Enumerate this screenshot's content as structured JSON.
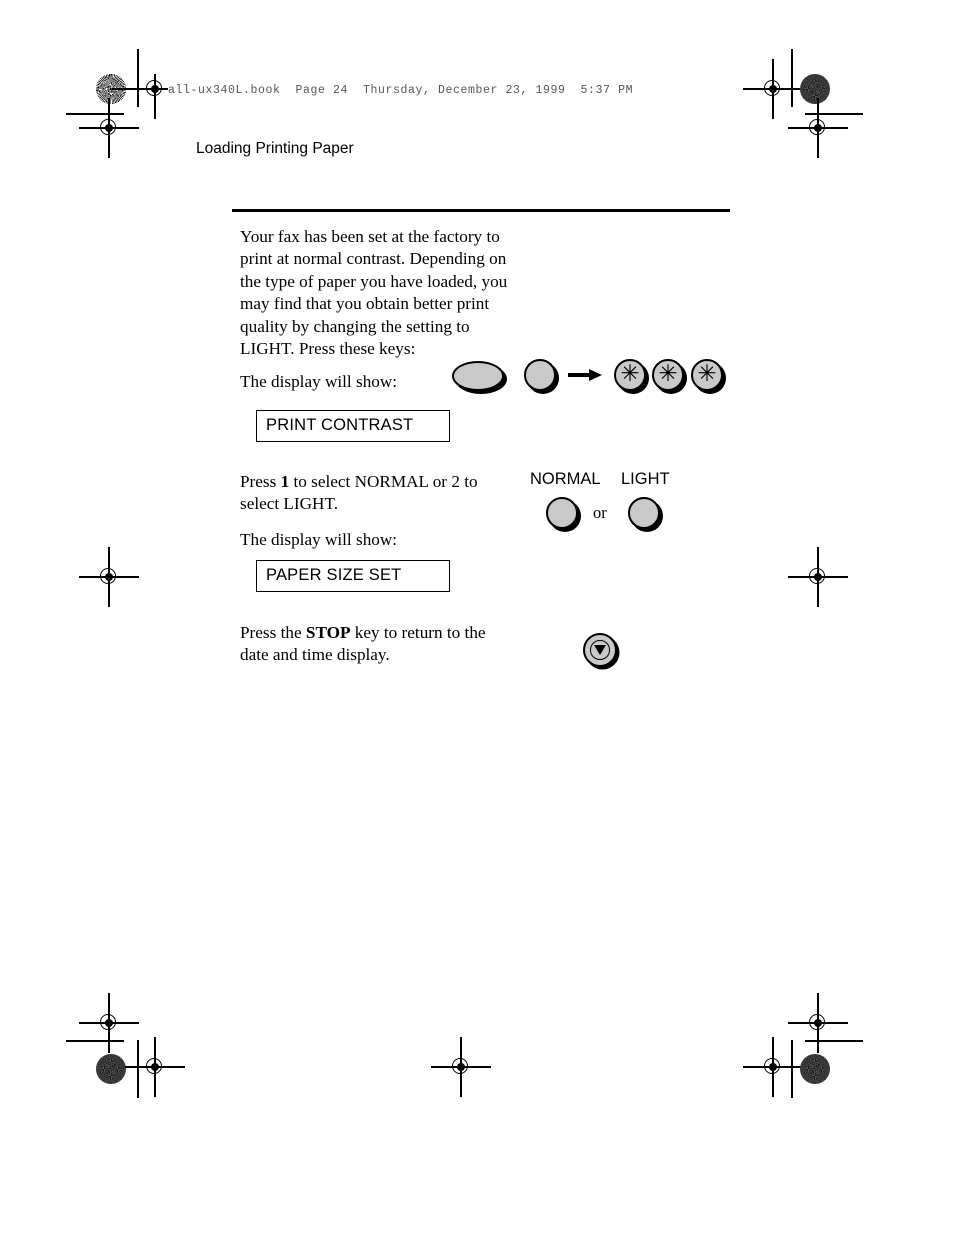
{
  "book_header": "all-ux340L.book  Page 24  Thursday, December 23, 1999  5:37 PM",
  "page_title": "Loading Printing Paper",
  "body": {
    "intro": "Your fax has been set at the factory to print at normal contrast. Depending on the type of paper you have loaded, you may find that you obtain better print quality by changing the setting to LIGHT. Press these keys:",
    "display_will_show_1": "The display will show:",
    "press_select_prefix": "Press ",
    "press_select_bold": "1",
    "press_select_suffix": " to select NORMAL or 2 to select LIGHT.",
    "display_will_show_2": "The display will show:",
    "stop_prefix": "Press the ",
    "stop_bold": "STOP",
    "stop_suffix": " key to return to the date and time display."
  },
  "displays": {
    "lcd_1": "PRINT CONTRAST",
    "lcd_2": "PAPER SIZE SET"
  },
  "keys": {
    "function_key": "",
    "start_key": "",
    "star_key_1": "✳",
    "star_key_2": "✳",
    "star_key_3": "✳"
  },
  "mode": {
    "normal_label": "NORMAL",
    "light_label": "LIGHT",
    "or_label": "or"
  },
  "colors": {
    "key_fill": "#c9c9c9",
    "ink": "#000000",
    "header_gray": "#555555",
    "paper": "#ffffff"
  }
}
